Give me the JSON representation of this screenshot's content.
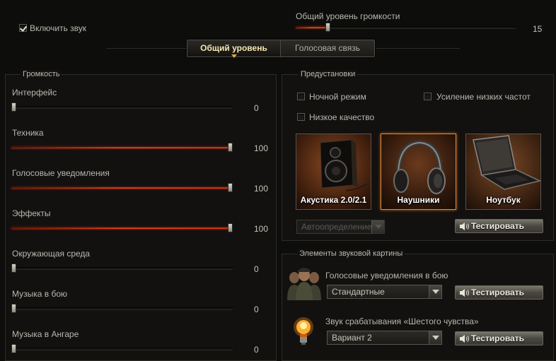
{
  "top": {
    "enable_sound_label": "Включить звук",
    "enable_sound_checked": true,
    "master_volume_label": "Общий уровень громкости",
    "master_volume_value": "15",
    "master_volume_fraction": 0.15
  },
  "tabs": [
    {
      "label": "Общий уровень",
      "active": true
    },
    {
      "label": "Голосовая связь",
      "active": false
    }
  ],
  "volume": {
    "title": "Громкость",
    "sliders": [
      {
        "label": "Интерфейс",
        "value": "0",
        "fraction": 0.0
      },
      {
        "label": "Техника",
        "value": "100",
        "fraction": 1.0
      },
      {
        "label": "Голосовые уведомления",
        "value": "100",
        "fraction": 1.0
      },
      {
        "label": "Эффекты",
        "value": "100",
        "fraction": 1.0
      },
      {
        "label": "Окружающая среда",
        "value": "0",
        "fraction": 0.0
      },
      {
        "label": "Музыка в бою",
        "value": "0",
        "fraction": 0.0
      },
      {
        "label": "Музыка в Ангаре",
        "value": "0",
        "fraction": 0.0
      }
    ]
  },
  "presets": {
    "title": "Предустановки",
    "night_mode_label": "Ночной режим",
    "bass_boost_label": "Усиление низких частот",
    "low_quality_label": "Низкое качество",
    "devices": [
      {
        "label": "Акустика 2.0/2.1",
        "selected": false,
        "icon": "speaker-icon"
      },
      {
        "label": "Наушники",
        "selected": true,
        "icon": "headphones-icon"
      },
      {
        "label": "Ноутбук",
        "selected": false,
        "icon": "laptop-icon"
      }
    ],
    "autodetect_value": "Автоопределение",
    "test_label": "Тестировать"
  },
  "elements": {
    "title": "Элементы звуковой картины",
    "voice_label": "Голосовые уведомления в бою",
    "voice_value": "Стандартные",
    "sixth_sense_label": "Звук срабатывания «Шестого чувства»",
    "sixth_sense_value": "Вариант 2",
    "test_label": "Тестировать"
  },
  "colors": {
    "accent_orange": "#e0893c",
    "slider_red": "#d83a14",
    "tab_active_text": "#f5e6b2"
  }
}
